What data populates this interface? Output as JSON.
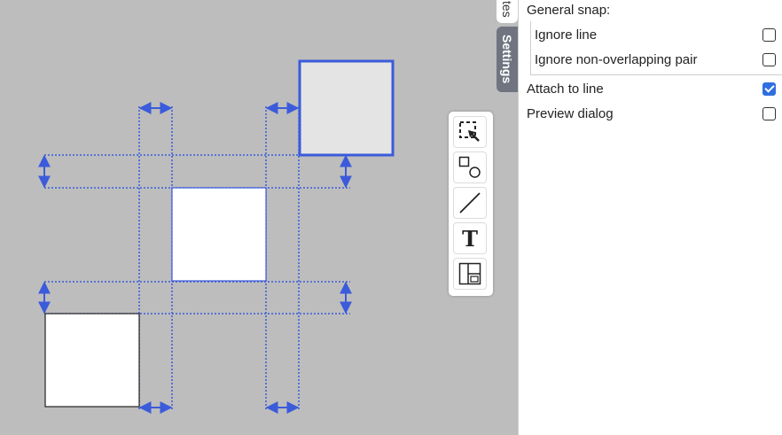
{
  "side_tabs": {
    "notes_label": "tes",
    "settings_label": "Settings"
  },
  "settings": {
    "general_snap_label": "General snap:",
    "ignore_line": {
      "label": "Ignore line",
      "checked": false
    },
    "ignore_non_overlapping": {
      "label": "Ignore non-overlapping pair",
      "checked": false
    },
    "attach_to_line": {
      "label": "Attach to line",
      "checked": true
    },
    "preview_dialog": {
      "label": "Preview dialog",
      "checked": false
    }
  },
  "toolbar": {
    "tools": [
      {
        "icon": "zoom-select-icon"
      },
      {
        "icon": "shapes-icon"
      },
      {
        "icon": "line-icon",
        "label": ""
      },
      {
        "icon": "text-icon",
        "label": "T"
      },
      {
        "icon": "layout-icon"
      }
    ]
  },
  "colors": {
    "canvas_bg": "#bdbdbd",
    "guide": "#3b5bdb",
    "selected_border": "#3b5bdb",
    "selected_fill": "#e4e4e4",
    "checked": "#2f6fe0"
  }
}
